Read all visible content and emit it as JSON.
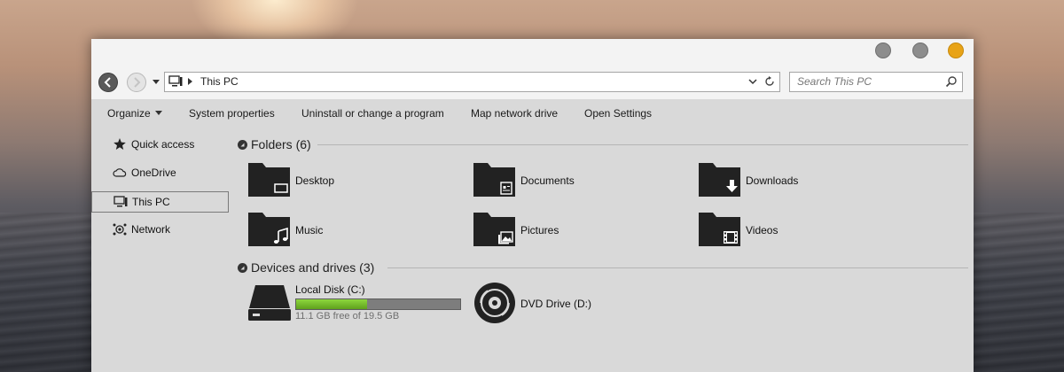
{
  "window": {
    "controls": {
      "accent": "#e8a317"
    }
  },
  "address_bar": {
    "location": "This PC"
  },
  "search": {
    "placeholder": "Search This PC"
  },
  "command_bar": {
    "items": [
      {
        "label": "Organize",
        "has_dropdown": true
      },
      {
        "label": "System properties"
      },
      {
        "label": "Uninstall or change a program"
      },
      {
        "label": "Map network drive"
      },
      {
        "label": "Open Settings"
      }
    ]
  },
  "sidebar": {
    "items": [
      {
        "label": "Quick access",
        "icon": "star-pin-icon"
      },
      {
        "label": "OneDrive",
        "icon": "cloud-icon"
      },
      {
        "label": "This PC",
        "icon": "computer-icon",
        "selected": true
      },
      {
        "label": "Network",
        "icon": "network-icon"
      }
    ]
  },
  "folders": {
    "heading": "Folders (6)",
    "items": [
      {
        "label": "Desktop",
        "icon": "desktop-folder-icon"
      },
      {
        "label": "Documents",
        "icon": "documents-folder-icon"
      },
      {
        "label": "Downloads",
        "icon": "downloads-folder-icon"
      },
      {
        "label": "Music",
        "icon": "music-folder-icon"
      },
      {
        "label": "Pictures",
        "icon": "pictures-folder-icon"
      },
      {
        "label": "Videos",
        "icon": "videos-folder-icon"
      }
    ]
  },
  "devices": {
    "heading": "Devices and drives (3)",
    "local_disk": {
      "label": "Local Disk (C:)",
      "free_text": "11.1 GB free of 19.5 GB",
      "used_fraction": 0.43,
      "bar_color": "#7dc52e"
    },
    "dvd": {
      "label": "DVD Drive (D:)"
    }
  }
}
